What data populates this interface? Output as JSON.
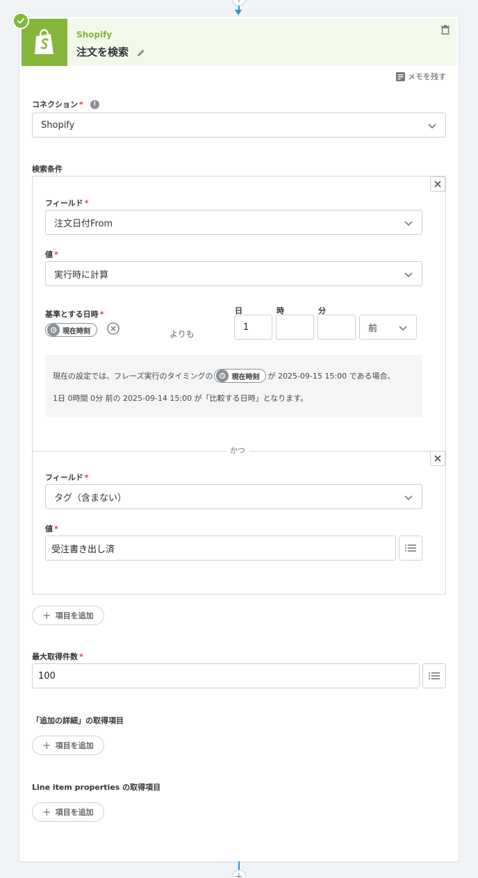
{
  "header": {
    "app_name": "Shopify",
    "action_title": "注文を検索"
  },
  "memo_label": "メモを残す",
  "connection": {
    "label": "コネクション",
    "required": "*",
    "value": "Shopify"
  },
  "conditions": {
    "section_label": "検索条件",
    "items": [
      {
        "field_label": "フィールド",
        "field_value": "注文日付From",
        "value_label": "値",
        "value_select": "実行時に計算",
        "base_label": "基準とする日時",
        "base_pill": "現在時刻",
        "yorimo": "よりも",
        "day_label": "日",
        "hour_label": "時",
        "minute_label": "分",
        "day_value": "1",
        "hour_value": "",
        "minute_value": "",
        "direction": "前",
        "note_line1_prefix": "現在の設定では、フレーズ実行のタイミングの",
        "note_pill": "現在時刻",
        "note_line1_suffix": "が 2025-09-15 15:00 である場合、",
        "note_line2": "1日 0時間 0分 前の 2025-09-14 15:00 が「比較する日時」となります。"
      },
      {
        "field_label": "フィールド",
        "field_value": "タグ（含まない）",
        "value_label": "値",
        "value_input": "受注書き出し済"
      }
    ],
    "conjunction": "かつ",
    "add_item": "項目を追加"
  },
  "max_count": {
    "label": "最大取得件数",
    "value": "100"
  },
  "extra_details": {
    "label": "「追加の詳細」の取得項目",
    "add_item": "項目を追加"
  },
  "line_item_properties": {
    "label": "Line item properties の取得項目",
    "add_item": "項目を追加"
  },
  "colors": {
    "brand_green": "#84b63c",
    "accent_blue": "#2d8fd5",
    "required_red": "#e03b3b"
  }
}
